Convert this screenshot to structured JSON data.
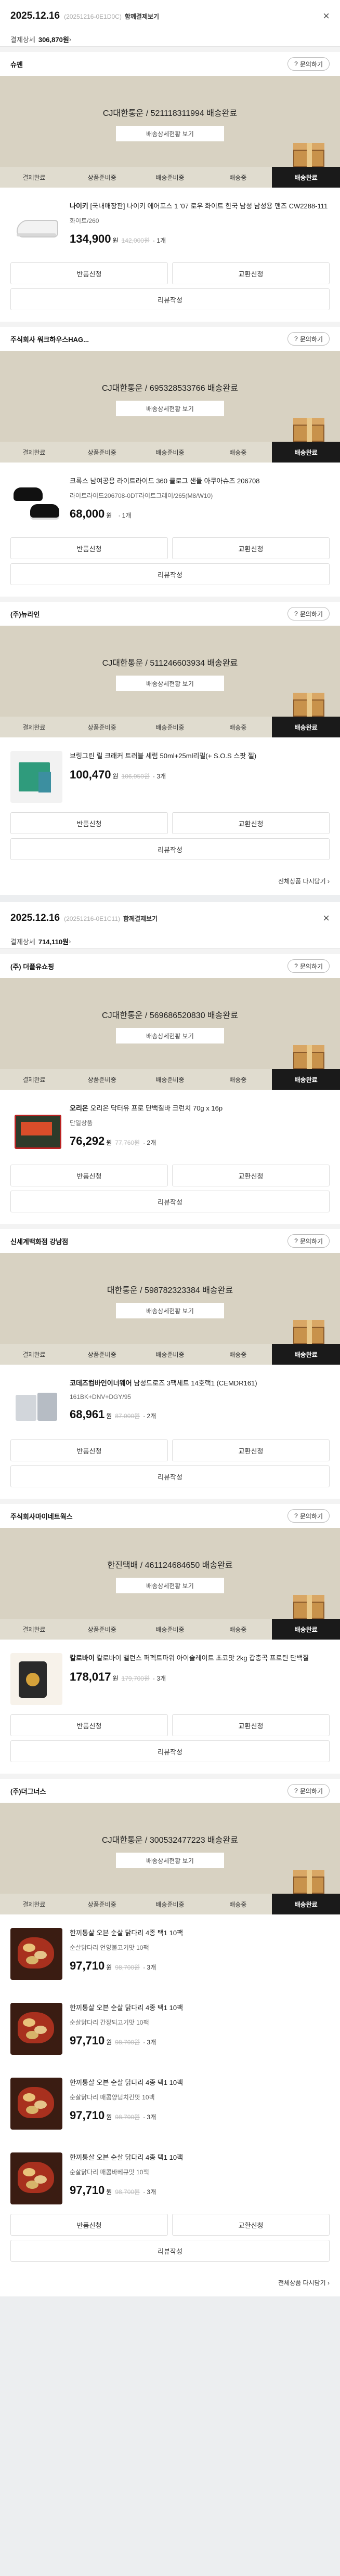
{
  "orders": [
    {
      "date": "2025.12.16",
      "id": "(20251216-0E1D0C)",
      "combine_label": "함께결제보기",
      "summary_label": "결제상세",
      "summary_amount": "306,870원",
      "summary_arrow": "›",
      "shipments": [
        {
          "seller": "슈펜",
          "inquiry_label": "문의하기",
          "carrier_info": "CJ대한통운 / 521118311994 배송완료",
          "track_button": "배송상세현황 보기",
          "stages": [
            "결제완료",
            "상품준비중",
            "배송준비중",
            "배송중",
            "배송완료"
          ],
          "active_stage": 4,
          "items": [
            {
              "brand": "나이키",
              "name": "[국내매장판] 나이키 에어포스 1 '07 로우 화이트 한국 남성 남성용 맨즈 CW2288-111",
              "option": "화이트/260",
              "price": "134,900",
              "won": "원",
              "original": "142,000원",
              "qty": "· 1개",
              "thumb": "shoe1"
            }
          ],
          "actions": [
            "반품신청",
            "교환신청",
            "리뷰작성"
          ]
        },
        {
          "seller": "주식회사 워크하우스HAG...",
          "inquiry_label": "문의하기",
          "carrier_info": "CJ대한통운 / 695328533766 배송완료",
          "track_button": "배송상세현황 보기",
          "stages": [
            "결제완료",
            "상품준비중",
            "배송준비중",
            "배송중",
            "배송완료"
          ],
          "active_stage": 4,
          "items": [
            {
              "brand": "",
              "name": "크록스 남여공용 라이트라이드 360 클로그 샌들 아쿠아슈즈 206708",
              "option": "라이트라이드206708-0DT라이트그레이/265(M8/W10)",
              "price": "68,000",
              "won": "원",
              "original": "",
              "qty": "· 1개",
              "thumb": "shoe2"
            }
          ],
          "actions": [
            "반품신청",
            "교환신청",
            "리뷰작성"
          ]
        },
        {
          "seller": "(주)뉴라인",
          "inquiry_label": "문의하기",
          "carrier_info": "CJ대한통운 / 511246603934 배송완료",
          "track_button": "배송상세현황 보기",
          "stages": [
            "결제완료",
            "상품준비중",
            "배송준비중",
            "배송중",
            "배송완료"
          ],
          "active_stage": 4,
          "items": [
            {
              "brand": "",
              "name": "브링그린 릴 크래커 트러블 세럼 50ml+25ml리필(+ S.O.S 스팟 젤)",
              "option": "",
              "price": "100,470",
              "won": "원",
              "original": "106,950원",
              "qty": "· 3개",
              "thumb": "green"
            }
          ],
          "actions": [
            "반품신청",
            "교환신청",
            "리뷰작성"
          ]
        }
      ],
      "more_label": "전체상품 다시담기 ›"
    },
    {
      "date": "2025.12.16",
      "id": "(20251216-0E1C11)",
      "combine_label": "함께결제보기",
      "summary_label": "결제상세",
      "summary_amount": "714,110원",
      "summary_arrow": "›",
      "shipments": [
        {
          "seller": "(주) 더플유쇼핑",
          "inquiry_label": "문의하기",
          "carrier_info": "CJ대한통운 / 569686520830 배송완료",
          "track_button": "배송상세현황 보기",
          "stages": [
            "결제완료",
            "상품준비중",
            "배송준비중",
            "배송중",
            "배송완료"
          ],
          "active_stage": 4,
          "items": [
            {
              "brand": "오리온",
              "name": "오리온 닥터유 프로 단백질바 크런치 70g x 16p",
              "option": "단일상품",
              "price": "76,292",
              "won": "원",
              "original": "77,760원",
              "qty": "· 2개",
              "thumb": "food"
            }
          ],
          "actions": [
            "반품신청",
            "교환신청",
            "리뷰작성"
          ]
        },
        {
          "seller": "신세계백화점 강남점",
          "inquiry_label": "문의하기",
          "carrier_info": "대한통운 / 598782323384 배송완료",
          "track_button": "배송상세현황 보기",
          "stages": [
            "결제완료",
            "상품준비중",
            "배송준비중",
            "배송중",
            "배송완료"
          ],
          "active_stage": 4,
          "items": [
            {
              "brand": "코데즈컴바인이너웨어",
              "name": "남성드로즈 3팩세트 14호랙1 (CEMDR161)",
              "option": "161BK+DNV+DGY/95",
              "price": "68,961",
              "won": "원",
              "original": "87,000원",
              "qty": "· 2개",
              "thumb": "pouch"
            }
          ],
          "actions": [
            "반품신청",
            "교환신청",
            "리뷰작성"
          ]
        },
        {
          "seller": "주식회사마이네트웍스",
          "inquiry_label": "문의하기",
          "carrier_info": "한진택배 / 461124684650 배송완료",
          "track_button": "배송상세현황 보기",
          "stages": [
            "결제완료",
            "상품준비중",
            "배송준비중",
            "배송중",
            "배송완료"
          ],
          "active_stage": 4,
          "items": [
            {
              "brand": "칼로바이",
              "name": "칼로바이 밸런스 퍼펙트파워 아이솔레이트 초코맛 2kg 갑충곡 프로틴 단백질",
              "option": "",
              "price": "178,017",
              "won": "원",
              "original": "179,700원",
              "qty": "· 3개",
              "thumb": "jar"
            }
          ],
          "actions": [
            "반품신청",
            "교환신청",
            "리뷰작성"
          ]
        },
        {
          "seller": "(주)더그너스",
          "inquiry_label": "문의하기",
          "carrier_info": "CJ대한통운 / 300532477223 배송완료",
          "track_button": "배송상세현황 보기",
          "stages": [
            "결제완료",
            "상품준비중",
            "배송준비중",
            "배송중",
            "배송완료"
          ],
          "active_stage": 4,
          "items": [
            {
              "brand": "",
              "name": "한끼통살 오븐 순살 닭다리 4종 택1 10팩",
              "option": "순살닭다리 언양불고기맛 10팩",
              "price": "97,710",
              "won": "원",
              "original": "98,700원",
              "qty": "· 3개",
              "thumb": "meat"
            },
            {
              "brand": "",
              "name": "한끼통살 오븐 순살 닭다리 4종 택1 10팩",
              "option": "순살닭다리 간장되고기맛 10팩",
              "price": "97,710",
              "won": "원",
              "original": "98,700원",
              "qty": "· 3개",
              "thumb": "meat"
            },
            {
              "brand": "",
              "name": "한끼통살 오븐 순살 닭다리 4종 택1 10팩",
              "option": "순살닭다리 매콤양념치킨맛 10팩",
              "price": "97,710",
              "won": "원",
              "original": "98,700원",
              "qty": "· 3개",
              "thumb": "meat"
            },
            {
              "brand": "",
              "name": "한끼통살 오븐 순살 닭다리 4종 택1 10팩",
              "option": "순살닭다리 매콤바베큐맛 10팩",
              "price": "97,710",
              "won": "원",
              "original": "98,700원",
              "qty": "· 3개",
              "thumb": "meat"
            }
          ],
          "actions": [
            "반품신청",
            "교환신청",
            "리뷰작성"
          ]
        }
      ],
      "more_label": "전체상품 다시담기 ›"
    }
  ],
  "icons": {
    "close": "×",
    "chevron": "›"
  }
}
